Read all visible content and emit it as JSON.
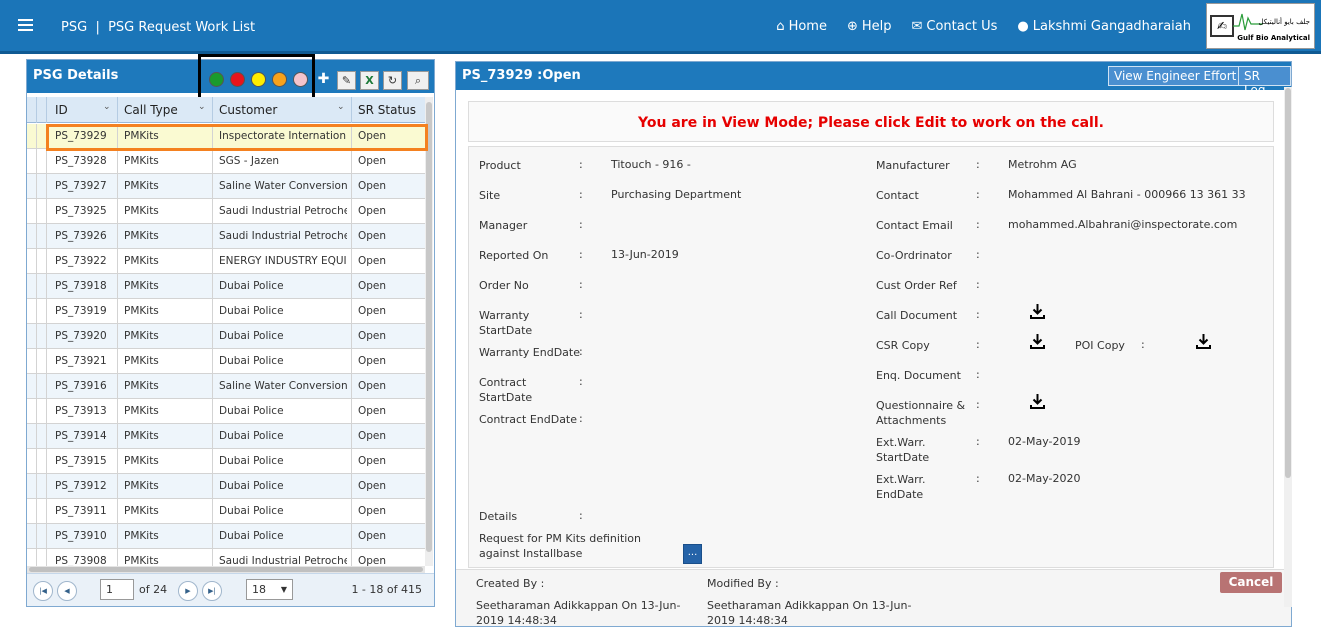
{
  "topbar": {
    "brand": "PSG",
    "breadcrumb": "PSG Request Work List",
    "nav": [
      {
        "icon": "home-icon",
        "label": "Home"
      },
      {
        "icon": "help-icon",
        "label": "Help"
      },
      {
        "icon": "chat-icon",
        "label": "Contact Us"
      },
      {
        "icon": "user-icon",
        "label": "Lakshmi Gangadharaiah"
      }
    ],
    "logo": {
      "arabic": "جلف بايو أناليتيكل",
      "english": "Gulf Bio Analytical"
    }
  },
  "left_panel": {
    "title": "PSG Details",
    "status_filters": [
      {
        "name": "green",
        "color": "#1a9b2d"
      },
      {
        "name": "red",
        "color": "#e8141c"
      },
      {
        "name": "yellow",
        "color": "#ffee00"
      },
      {
        "name": "orange",
        "color": "#f7a21b"
      },
      {
        "name": "pink",
        "color": "#f4c4cc"
      }
    ],
    "tools": [
      {
        "icon": "add-icon",
        "glyph": "✚"
      },
      {
        "icon": "edit-icon",
        "glyph": "✎"
      },
      {
        "icon": "excel-icon",
        "glyph": "X"
      },
      {
        "icon": "refresh-icon",
        "glyph": "↻"
      },
      {
        "icon": "search-icon",
        "glyph": "🔍"
      }
    ],
    "columns": [
      "ID",
      "Call Type",
      "Customer",
      "SR Status"
    ],
    "rows": [
      [
        "PS_73929",
        "PMKits",
        "Inspectorate Internation...",
        "Open"
      ],
      [
        "PS_73928",
        "PMKits",
        "SGS - Jazen",
        "Open"
      ],
      [
        "PS_73927",
        "PMKits",
        "Saline Water Conversion ...",
        "Open"
      ],
      [
        "PS_73925",
        "PMKits",
        "Saudi Industrial Petroche...",
        "Open"
      ],
      [
        "PS_73926",
        "PMKits",
        "Saudi Industrial Petroche...",
        "Open"
      ],
      [
        "PS_73922",
        "PMKits",
        "ENERGY INDUSTRY EQUIP...",
        "Open"
      ],
      [
        "PS_73918",
        "PMKits",
        "Dubai Police",
        "Open"
      ],
      [
        "PS_73919",
        "PMKits",
        "Dubai Police",
        "Open"
      ],
      [
        "PS_73920",
        "PMKits",
        "Dubai Police",
        "Open"
      ],
      [
        "PS_73921",
        "PMKits",
        "Dubai Police",
        "Open"
      ],
      [
        "PS_73916",
        "PMKits",
        "Saline Water Conversion ...",
        "Open"
      ],
      [
        "PS_73913",
        "PMKits",
        "Dubai Police",
        "Open"
      ],
      [
        "PS_73914",
        "PMKits",
        "Dubai Police",
        "Open"
      ],
      [
        "PS_73915",
        "PMKits",
        "Dubai Police",
        "Open"
      ],
      [
        "PS_73912",
        "PMKits",
        "Dubai Police",
        "Open"
      ],
      [
        "PS_73911",
        "PMKits",
        "Dubai Police",
        "Open"
      ],
      [
        "PS_73910",
        "PMKits",
        "Dubai Police",
        "Open"
      ],
      [
        "PS_73908",
        "PMKits",
        "Saudi Industrial Petroche...",
        "Open"
      ]
    ],
    "selected_row": 0,
    "pager": {
      "page": "1",
      "of_label": "of 24",
      "page_size": "18",
      "range": "1 - 18 of 415"
    }
  },
  "right_panel": {
    "title": "PS_73929 :Open",
    "buttons": {
      "view_effort": "View Engineer Effort",
      "sr_log": "SR Log",
      "cancel": "Cancel"
    },
    "view_mode_msg": "You are in View Mode; Please click Edit to work on the call.",
    "left_fields": [
      {
        "label": "Product",
        "value": "Titouch - 916 -"
      },
      {
        "label": "Site",
        "value": "Purchasing Department"
      },
      {
        "label": "Manager",
        "value": ""
      },
      {
        "label": "Reported On",
        "value": "13-Jun-2019"
      },
      {
        "label": "Order No",
        "value": ""
      },
      {
        "label": "Warranty StartDate",
        "value": ""
      },
      {
        "label": "Warranty EndDate",
        "value": ""
      },
      {
        "label": "Contract StartDate",
        "value": ""
      },
      {
        "label": "Contract EndDate",
        "value": ""
      }
    ],
    "right_fields": [
      {
        "label": "Manufacturer",
        "value": "Metrohm AG"
      },
      {
        "label": "Contact",
        "value": "Mohammed Al Bahrani - 000966 13 361 33"
      },
      {
        "label": "Contact Email",
        "value": "mohammed.Albahrani@inspectorate.com"
      },
      {
        "label": "Co-Ordrinator",
        "value": ""
      },
      {
        "label": "Cust Order Ref",
        "value": ""
      },
      {
        "label": "Call Document",
        "value": ""
      },
      {
        "label": "CSR Copy",
        "value": ""
      },
      {
        "label": "Enq. Document",
        "value": ""
      },
      {
        "label": "Questionnaire & Attachments",
        "value": ""
      },
      {
        "label": "Ext.Warr. StartDate",
        "value": "02-May-2019"
      },
      {
        "label": "Ext.Warr. EndDate",
        "value": "02-May-2020"
      }
    ],
    "poi_copy_label": "POI Copy",
    "details_label": "Details",
    "details_text": "Request for PM Kits definition against Installbase",
    "more_label": "...",
    "created_by_label": "Created By :",
    "created_by": "Seetharaman Adikkappan On 13-Jun-2019 14:48:34",
    "modified_by_label": "Modified By :",
    "modified_by": "Seetharaman Adikkappan On 13-Jun-2019 14:48:34"
  }
}
